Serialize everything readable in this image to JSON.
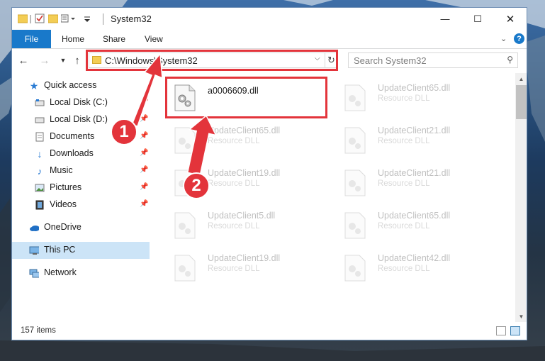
{
  "window": {
    "title": "System32",
    "controls": {
      "minimize": "—",
      "maximize": "☐",
      "close": "✕"
    }
  },
  "ribbon": {
    "tabs": [
      "File",
      "Home",
      "Share",
      "View"
    ],
    "help": "?"
  },
  "address": {
    "path": "C:\\Windows\\System32",
    "search_placeholder": "Search System32"
  },
  "nav": {
    "items": [
      {
        "label": "Quick access",
        "icon": "star-icon"
      },
      {
        "label": "Local Disk (C:)",
        "icon": "drive-icon",
        "pinned": true
      },
      {
        "label": "Local Disk (D:)",
        "icon": "drive-icon",
        "pinned": true
      },
      {
        "label": "Documents",
        "icon": "documents-icon",
        "pinned": true
      },
      {
        "label": "Downloads",
        "icon": "downloads-icon",
        "pinned": true
      },
      {
        "label": "Music",
        "icon": "music-icon",
        "pinned": true
      },
      {
        "label": "Pictures",
        "icon": "pictures-icon",
        "pinned": true
      },
      {
        "label": "Videos",
        "icon": "videos-icon",
        "pinned": true
      },
      {
        "label": "OneDrive",
        "icon": "cloud-icon"
      },
      {
        "label": "This PC",
        "icon": "computer-icon",
        "selected": true
      },
      {
        "label": "Network",
        "icon": "network-icon"
      }
    ]
  },
  "files": [
    {
      "name": "a0006609.dll",
      "desc": "",
      "highlighted": true
    },
    {
      "name": "UpdateClient65.dll",
      "desc": "Resource DLL"
    },
    {
      "name": "UpdateClient65.dll",
      "desc": "Resource DLL"
    },
    {
      "name": "UpdateClient21.dll",
      "desc": "Resource DLL"
    },
    {
      "name": "UpdateClient19.dll",
      "desc": "Resource DLL"
    },
    {
      "name": "UpdateClient21.dll",
      "desc": "Resource DLL"
    },
    {
      "name": "UpdateClient5.dll",
      "desc": "Resource DLL"
    },
    {
      "name": "UpdateClient65.dll",
      "desc": "Resource DLL"
    },
    {
      "name": "UpdateClient19.dll",
      "desc": "Resource DLL"
    },
    {
      "name": "UpdateClient42.dll",
      "desc": "Resource DLL"
    }
  ],
  "status": {
    "count": "157 items"
  },
  "annotations": {
    "step1": "1",
    "step2": "2"
  },
  "colors": {
    "accent": "#1979ca",
    "annotation": "#e3343b",
    "selected": "#cce4f7"
  }
}
